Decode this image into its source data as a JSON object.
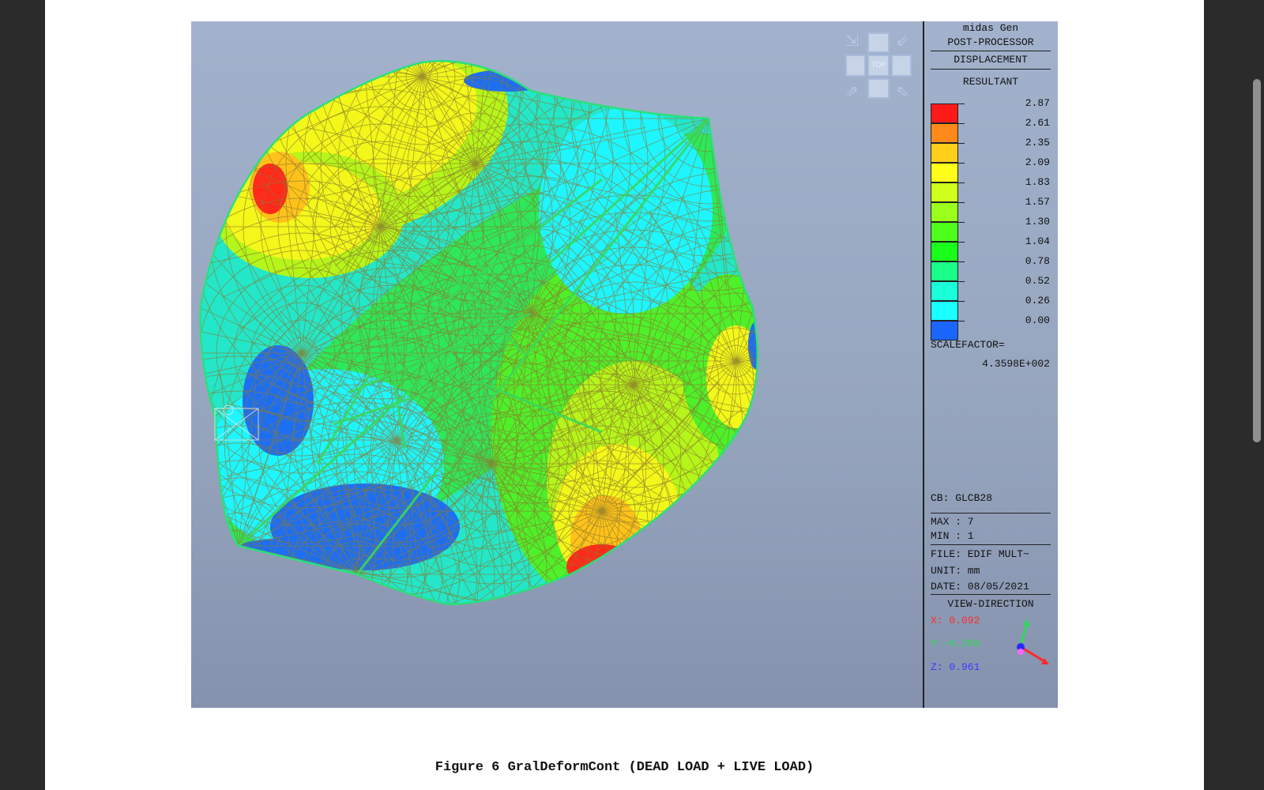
{
  "figure": {
    "caption": "Figure 6 GralDeformCont (DEAD LOAD + LIVE LOAD)"
  },
  "view_cube": {
    "label": "TOP"
  },
  "legend": {
    "header_line1": "midas Gen",
    "header_line2": "POST-PROCESSOR",
    "result_type": "DISPLACEMENT",
    "component": "RESULTANT",
    "values": [
      "2.87",
      "2.61",
      "2.35",
      "2.09",
      "1.83",
      "1.57",
      "1.30",
      "1.04",
      "0.78",
      "0.52",
      "0.26",
      "0.00"
    ],
    "colors": [
      "#ff1a1a",
      "#ff8a1a",
      "#ffcf1a",
      "#ffff1a",
      "#cfff1a",
      "#9aff1a",
      "#4dff1a",
      "#1aff1a",
      "#1aff8a",
      "#1affd9",
      "#1affff",
      "#1a66ff"
    ],
    "scalefactor_label": "SCALEFACTOR=",
    "scalefactor_value": "4.3598E+002",
    "cb": "CB: GLCB28",
    "max": "MAX : 7",
    "min": "MIN : 1",
    "file": "FILE: EDIF MULT~",
    "unit": "UNIT: mm",
    "date": "DATE: 08/05/2021",
    "view_direction_title": "VIEW-DIRECTION",
    "vx": "X: 0.092",
    "vy": "Y:-0.260",
    "vz": "Z: 0.961",
    "axis_colors": {
      "x": "#ff2a2a",
      "y": "#2add55",
      "z": "#3a3aff"
    }
  }
}
